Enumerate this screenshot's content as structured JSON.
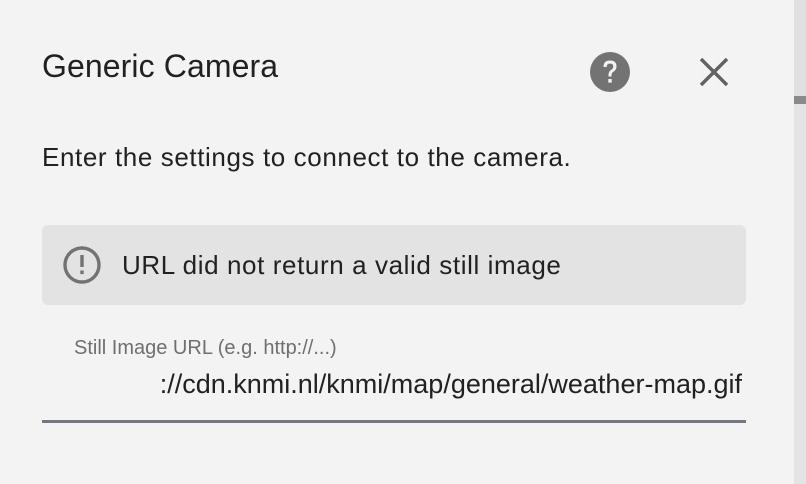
{
  "dialog": {
    "title": "Generic Camera",
    "description": "Enter the settings to connect to the camera.",
    "help_icon": "help-circle-icon",
    "close_icon": "close-icon"
  },
  "alert": {
    "icon": "alert-circle-outline-icon",
    "message": "URL did not return a valid still image"
  },
  "form": {
    "still_image_url": {
      "label": "Still Image URL (e.g. http://...)",
      "value": "://cdn.knmi.nl/knmi/map/general/weather-map.gif"
    }
  },
  "colors": {
    "background": "#f3f3f3",
    "alert_background": "#e3e3e4",
    "icon": "#737373",
    "underline": "#737780",
    "label": "#6f6f6f"
  }
}
